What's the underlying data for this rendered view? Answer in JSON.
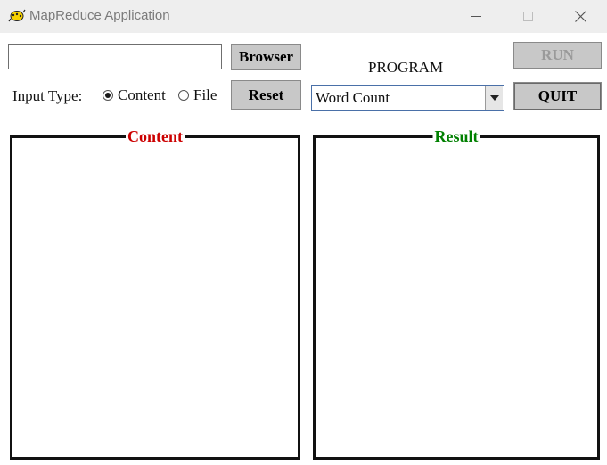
{
  "window": {
    "title": "MapReduce Application",
    "controls": [
      "minimize-icon",
      "maximize-icon",
      "close-icon"
    ]
  },
  "input": {
    "value": ""
  },
  "buttons": {
    "browser": "Browser",
    "reset": "Reset",
    "run": "RUN",
    "quit": "QUIT"
  },
  "input_type": {
    "label": "Input Type:",
    "options": [
      {
        "label": "Content",
        "selected": true
      },
      {
        "label": "File",
        "selected": false
      }
    ]
  },
  "program": {
    "label": "PROGRAM",
    "selected": "Word Count"
  },
  "panels": {
    "content": {
      "title": "Content",
      "color": "#cc0000"
    },
    "result": {
      "title": "Result",
      "color": "#008000"
    }
  }
}
